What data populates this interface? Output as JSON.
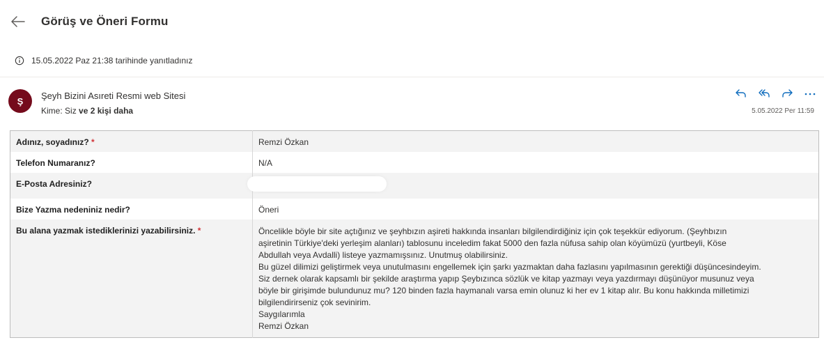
{
  "header": {
    "title": "Görüş ve Öneri Formu"
  },
  "notice": {
    "text": "15.05.2022 Paz 21:38 tarihinde yanıtladınız"
  },
  "message": {
    "avatar_initial": "Ş",
    "sender": "Şeyh Bizini Asıreti Resmi web Sitesi",
    "to_label": "Kime:",
    "to_you": "Siz",
    "to_more": "ve 2 kişi daha",
    "date": "5.05.2022 Per 11:59"
  },
  "colors": {
    "avatar": "#750b1c",
    "action_icons": "#0f6cbd",
    "required": "#d13438"
  },
  "form": {
    "rows": [
      {
        "label": "Adınız, soyadınız?",
        "required": "*",
        "value": "Remzi Özkan"
      },
      {
        "label": "Telefon Numaranız?",
        "value": "N/A"
      },
      {
        "label": "E-Posta Adresiniz?",
        "value": ""
      },
      {
        "label": "Bize Yazma nedeniniz nedir?",
        "value": "Öneri"
      },
      {
        "label": "Bu alana yazmak istediklerinizi yazabilirsiniz.",
        "required": "*",
        "lines": [
          "Öncelikle böyle bir site açtığınız ve şeyhbızın aşireti hakkında insanları bilgilendirdiğiniz için çok teşekkür ediyorum. (Şeyhbızın",
          "aşiretinin Türkiye'deki yerleşim alanları) tablosunu inceledim fakat 5000 den fazla nüfusa sahip olan köyümüzü (yurtbeyli, Köse",
          "Abdullah veya Avdalli) listeye yazmamışsınız. Unutmuş olabilirsiniz.",
          "Bu güzel dilimizi geliştirmek veya unutulmasını engellemek için şarkı yazmaktan daha fazlasını yapılmasının gerektiği düşüncesindeyim.",
          "Siz dernek olarak kapsamlı bir şekilde araştırma yapıp Şeybızınca sözlük ve kitap yazmayı veya yazdırmayı düşünüyor musunuz veya",
          "böyle bir girişimde bulundunuz mu? 120 binden fazla haymanalı varsa emin olunuz ki her ev 1 kitap alır. Bu konu hakkında milletimizi",
          "bilgilendirirseniz çok sevinirim.",
          "Saygılarımla",
          "Remzi Özkan"
        ]
      }
    ]
  }
}
